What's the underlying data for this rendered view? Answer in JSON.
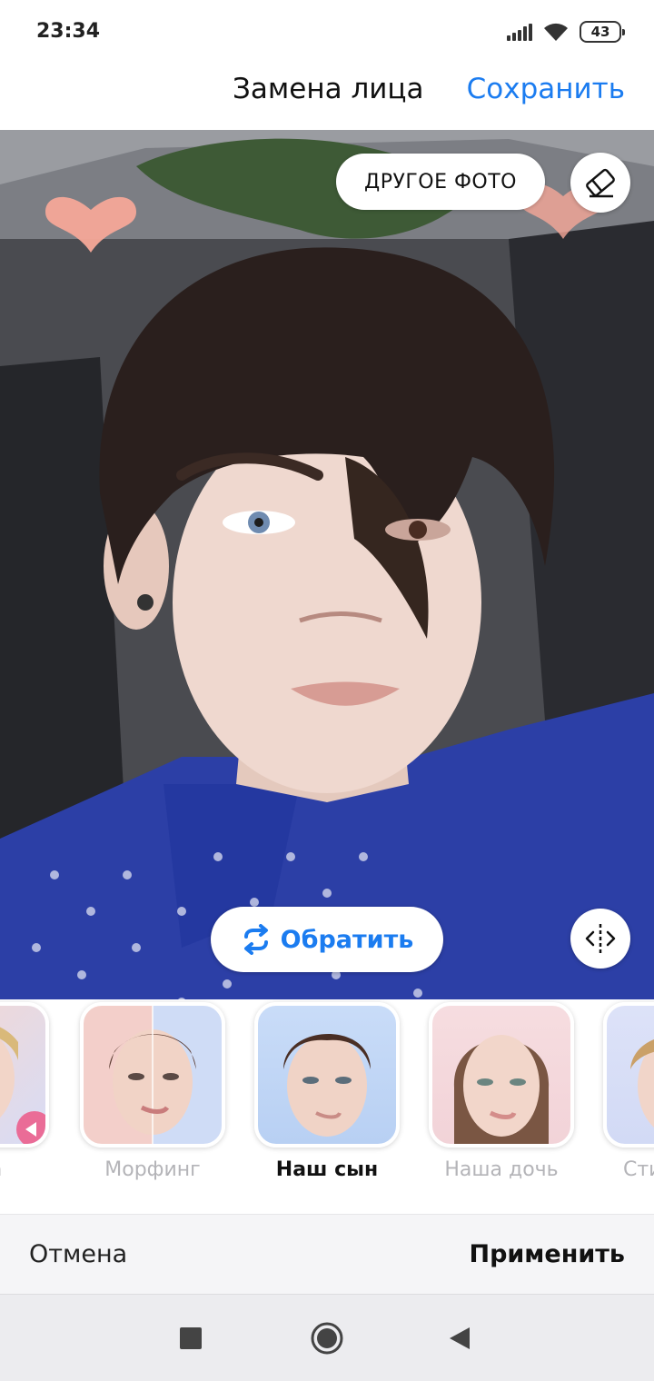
{
  "status_bar": {
    "time": "23:34",
    "battery": "43"
  },
  "header": {
    "title": "Замена лица",
    "save_label": "Сохранить"
  },
  "photo": {
    "other_photo_label": "ДРУГОЕ ФОТО",
    "reverse_label": "Обратить"
  },
  "filters": [
    {
      "label": "лица",
      "active": false
    },
    {
      "label": "Морфинг",
      "active": false
    },
    {
      "label": "Наш сын",
      "active": true
    },
    {
      "label": "Наша дочь",
      "active": false
    },
    {
      "label": "Сти",
      "active": false
    }
  ],
  "action_bar": {
    "cancel_label": "Отмена",
    "apply_label": "Применить"
  },
  "colors": {
    "accent": "#1b7cf0",
    "heart": "#f6a898"
  },
  "icons": [
    "signal-icon",
    "wifi-icon",
    "battery-icon",
    "eraser-icon",
    "swap-icon",
    "compare-icon",
    "stop-icon",
    "home-icon",
    "back-icon"
  ]
}
